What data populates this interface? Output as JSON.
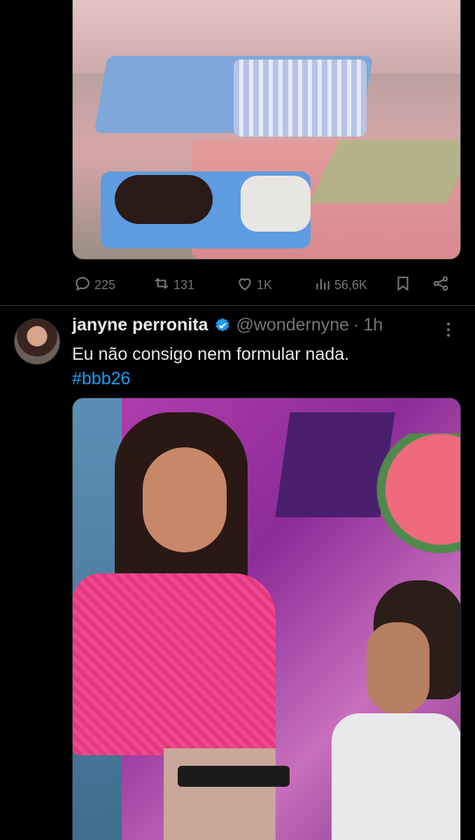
{
  "tweet_prev": {
    "stats": {
      "replies": "225",
      "reposts": "131",
      "likes": "1K",
      "views": "56,6K"
    }
  },
  "tweet": {
    "display_name": "janyne perronita",
    "handle": "@wondernyne",
    "separator": "·",
    "time": "1h",
    "text": "Eu não consigo nem formular nada.",
    "hashtag": "#bbb26"
  },
  "colors": {
    "background": "#000000",
    "text": "#e7e9ea",
    "muted": "#71767b",
    "link": "#1d9bf0",
    "verified": "#1d9bf0"
  },
  "icons": {
    "reply": "reply-icon",
    "repost": "repost-icon",
    "like": "heart-icon",
    "views": "views-icon",
    "bookmark": "bookmark-icon",
    "share": "share-icon",
    "verified": "verified-badge-icon",
    "more": "more-icon"
  }
}
